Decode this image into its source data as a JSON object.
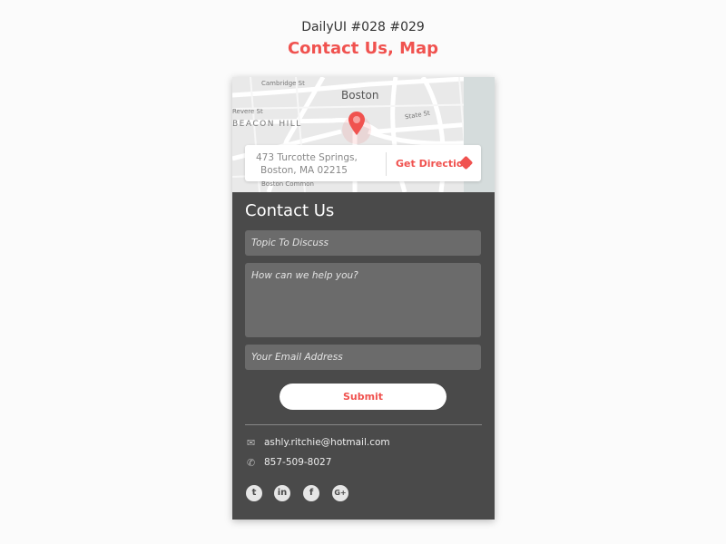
{
  "header": {
    "subtitle": "DailyUI #028 #029",
    "title": "Contact Us, Map"
  },
  "map": {
    "city": "Boston",
    "labels": [
      "Cambridge St",
      "Revere St",
      "BEACON HILL",
      "State St",
      "Boston Common"
    ],
    "pin_icon": "map-pin-icon",
    "address_line1": "473 Turcotte Springs,",
    "address_line2": "Boston,  MA 02215",
    "direction_label": "Get Direction",
    "direction_icon": "directions-icon"
  },
  "form": {
    "title": "Contact Us",
    "topic_placeholder": "Topic To Discuss",
    "message_placeholder": "How can we help you?",
    "email_placeholder": "Your Email Address",
    "submit_label": "Submit"
  },
  "contact": {
    "email": "ashly.ritchie@hotmail.com",
    "phone": "857-509-8027"
  },
  "social": [
    {
      "name": "twitter",
      "glyph": "t"
    },
    {
      "name": "linkedin",
      "glyph": "in"
    },
    {
      "name": "facebook",
      "glyph": "f"
    },
    {
      "name": "google-plus",
      "glyph": "G+"
    }
  ],
  "colors": {
    "accent": "#f0524f",
    "panel": "#4a4a4a",
    "field": "#6b6b6b"
  }
}
